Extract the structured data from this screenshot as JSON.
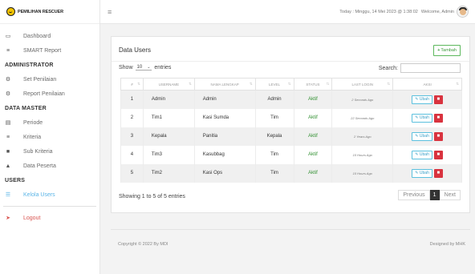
{
  "brand": {
    "name": "PEMILIHAN RESCUER"
  },
  "sidebar": {
    "items": [
      {
        "icon": "monitor-icon",
        "glyph": "▭",
        "label": "Dashboard"
      },
      {
        "icon": "list-icon",
        "glyph": "≡",
        "label": "SMART Report"
      }
    ],
    "head_admin": "ADMINISTRATOR",
    "admin_items": [
      {
        "icon": "gears-icon",
        "glyph": "⚙",
        "label": "Set Penilaian"
      },
      {
        "icon": "settings-icon",
        "glyph": "⚙",
        "label": "Report Penilaian"
      }
    ],
    "head_master": "DATA MASTER",
    "master_items": [
      {
        "icon": "calendar-icon",
        "glyph": "▤",
        "label": "Periode"
      },
      {
        "icon": "list-icon",
        "glyph": "≡",
        "label": "Kriteria"
      },
      {
        "icon": "bookmark-icon",
        "glyph": "■",
        "label": "Sub Kriteria"
      },
      {
        "icon": "user-icon",
        "glyph": "▲",
        "label": "Data Peserta"
      }
    ],
    "head_users": "USERS",
    "users_item": {
      "icon": "users-icon",
      "glyph": "☰",
      "label": "Kelola Users"
    },
    "logout": {
      "icon": "logout-icon",
      "glyph": "➤",
      "label": "Logout"
    }
  },
  "topbar": {
    "datetime": "Today : Minggu, 14 Mei 2023 @ 1:38:02",
    "welcome": "Welcome, Admin"
  },
  "card": {
    "title": "Data Users",
    "add_button": "Tambah",
    "show_label": "Show",
    "entries_value": "10",
    "entries_label": "entries",
    "search_label": "Search:"
  },
  "table": {
    "headers": [
      "#",
      "USERNAME",
      "NAMA LENGKAP",
      "LEVEL",
      "STATUS",
      "LAST LOGIN",
      "AKSI"
    ],
    "rows": [
      {
        "no": "1",
        "username": "Admin",
        "nama": "Admin",
        "level": "Admin",
        "status": "Aktif",
        "last": "2 Seconds Ago"
      },
      {
        "no": "2",
        "username": "Tim1",
        "nama": "Kasi Sumda",
        "level": "Tim",
        "status": "Aktif",
        "last": "22 Seconds Ago"
      },
      {
        "no": "3",
        "username": "Kepala",
        "nama": "Panitia",
        "level": "Kepala",
        "status": "Aktif",
        "last": "2 Years Ago"
      },
      {
        "no": "4",
        "username": "Tim3",
        "nama": "Kasubbag",
        "level": "Tim",
        "status": "Aktif",
        "last": "10 Hours Ago"
      },
      {
        "no": "5",
        "username": "Tim2",
        "nama": "Kasi Ops",
        "level": "Tim",
        "status": "Aktif",
        "last": "10 Hours Ago"
      }
    ],
    "edit_label": "Ubah",
    "info": "Showing 1 to 5 of 5 entries",
    "prev": "Previous",
    "current_page": "1",
    "next": "Next"
  },
  "footer": {
    "copyright": "Copyright © 2022 By MDI",
    "designed": "Designed by MHK"
  },
  "colors": {
    "accent": "#5bb5e7",
    "success": "#5cb85c",
    "danger": "#d9333f"
  }
}
